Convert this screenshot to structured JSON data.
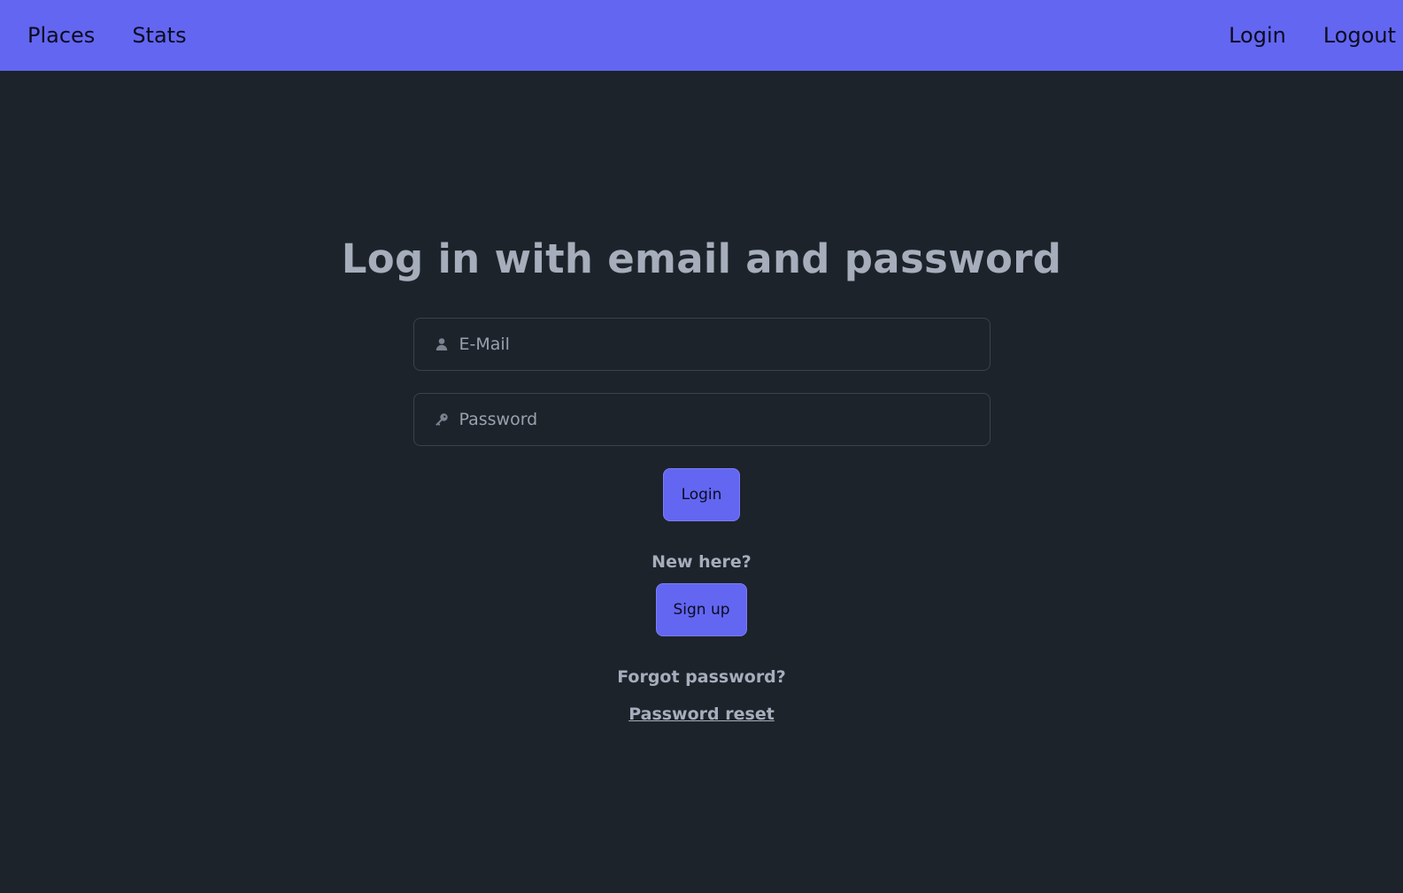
{
  "nav": {
    "left": [
      {
        "label": "Places"
      },
      {
        "label": "Stats"
      }
    ],
    "right": [
      {
        "label": "Login"
      },
      {
        "label": "Logout"
      }
    ]
  },
  "main": {
    "title": "Log in with email and password",
    "email": {
      "placeholder": "E-Mail",
      "value": "",
      "icon": "user-icon"
    },
    "password": {
      "placeholder": "Password",
      "value": "",
      "icon": "key-icon"
    },
    "login_button": "Login",
    "new_here": "New here?",
    "signup_button": "Sign up",
    "forgot_password": "Forgot password?",
    "reset_link": "Password reset"
  },
  "colors": {
    "accent": "#6366f1",
    "background": "#1d232a",
    "text_muted": "#a6adbb"
  }
}
